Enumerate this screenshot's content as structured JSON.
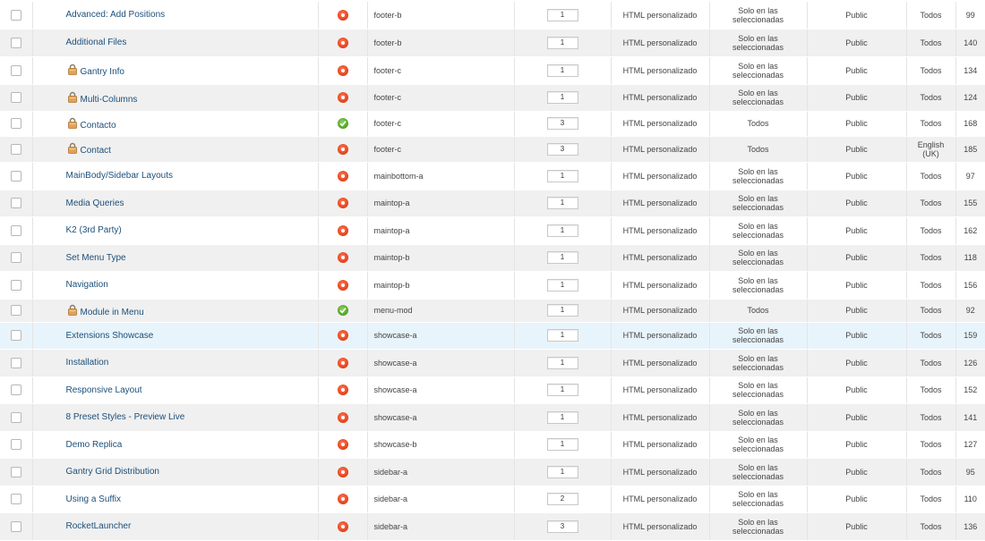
{
  "modules": [
    {
      "title": "Advanced: Add Positions",
      "locked": false,
      "status": "unpublished",
      "position": "footer-b",
      "order": "1",
      "type": "HTML personalizado",
      "pages": "Solo en las seleccionadas",
      "access": "Public",
      "language": "Todos",
      "id": "99"
    },
    {
      "title": "Additional Files",
      "locked": false,
      "status": "unpublished",
      "position": "footer-b",
      "order": "1",
      "type": "HTML personalizado",
      "pages": "Solo en las seleccionadas",
      "access": "Public",
      "language": "Todos",
      "id": "140"
    },
    {
      "title": "Gantry Info",
      "locked": true,
      "status": "unpublished",
      "position": "footer-c",
      "order": "1",
      "type": "HTML personalizado",
      "pages": "Solo en las seleccionadas",
      "access": "Public",
      "language": "Todos",
      "id": "134"
    },
    {
      "title": "Multi-Columns",
      "locked": true,
      "status": "unpublished",
      "position": "footer-c",
      "order": "1",
      "type": "HTML personalizado",
      "pages": "Solo en las seleccionadas",
      "access": "Public",
      "language": "Todos",
      "id": "124"
    },
    {
      "title": "Contacto",
      "locked": true,
      "status": "published",
      "position": "footer-c",
      "order": "3",
      "type": "HTML personalizado",
      "pages": "Todos",
      "access": "Public",
      "language": "Todos",
      "id": "168"
    },
    {
      "title": "Contact",
      "locked": true,
      "status": "unpublished",
      "position": "footer-c",
      "order": "3",
      "type": "HTML personalizado",
      "pages": "Todos",
      "access": "Public",
      "language": "English (UK)",
      "id": "185"
    },
    {
      "title": "MainBody/Sidebar Layouts",
      "locked": false,
      "status": "unpublished",
      "position": "mainbottom-a",
      "order": "1",
      "type": "HTML personalizado",
      "pages": "Solo en las seleccionadas",
      "access": "Public",
      "language": "Todos",
      "id": "97"
    },
    {
      "title": "Media Queries",
      "locked": false,
      "status": "unpublished",
      "position": "maintop-a",
      "order": "1",
      "type": "HTML personalizado",
      "pages": "Solo en las seleccionadas",
      "access": "Public",
      "language": "Todos",
      "id": "155"
    },
    {
      "title": "K2 (3rd Party)",
      "locked": false,
      "status": "unpublished",
      "position": "maintop-a",
      "order": "1",
      "type": "HTML personalizado",
      "pages": "Solo en las seleccionadas",
      "access": "Public",
      "language": "Todos",
      "id": "162"
    },
    {
      "title": "Set Menu Type",
      "locked": false,
      "status": "unpublished",
      "position": "maintop-b",
      "order": "1",
      "type": "HTML personalizado",
      "pages": "Solo en las seleccionadas",
      "access": "Public",
      "language": "Todos",
      "id": "118"
    },
    {
      "title": "Navigation",
      "locked": false,
      "status": "unpublished",
      "position": "maintop-b",
      "order": "1",
      "type": "HTML personalizado",
      "pages": "Solo en las seleccionadas",
      "access": "Public",
      "language": "Todos",
      "id": "156"
    },
    {
      "title": "Module in Menu",
      "locked": true,
      "status": "published",
      "position": "menu-mod",
      "order": "1",
      "type": "HTML personalizado",
      "pages": "Todos",
      "access": "Public",
      "language": "Todos",
      "id": "92"
    },
    {
      "title": "Extensions Showcase",
      "locked": false,
      "status": "unpublished",
      "position": "showcase-a",
      "order": "1",
      "type": "HTML personalizado",
      "pages": "Solo en las seleccionadas",
      "access": "Public",
      "language": "Todos",
      "id": "159",
      "highlight": true
    },
    {
      "title": "Installation",
      "locked": false,
      "status": "unpublished",
      "position": "showcase-a",
      "order": "1",
      "type": "HTML personalizado",
      "pages": "Solo en las seleccionadas",
      "access": "Public",
      "language": "Todos",
      "id": "126"
    },
    {
      "title": "Responsive Layout",
      "locked": false,
      "status": "unpublished",
      "position": "showcase-a",
      "order": "1",
      "type": "HTML personalizado",
      "pages": "Solo en las seleccionadas",
      "access": "Public",
      "language": "Todos",
      "id": "152"
    },
    {
      "title": "8 Preset Styles - Preview Live",
      "locked": false,
      "status": "unpublished",
      "position": "showcase-a",
      "order": "1",
      "type": "HTML personalizado",
      "pages": "Solo en las seleccionadas",
      "access": "Public",
      "language": "Todos",
      "id": "141"
    },
    {
      "title": "Demo Replica",
      "locked": false,
      "status": "unpublished",
      "position": "showcase-b",
      "order": "1",
      "type": "HTML personalizado",
      "pages": "Solo en las seleccionadas",
      "access": "Public",
      "language": "Todos",
      "id": "127"
    },
    {
      "title": "Gantry Grid Distribution",
      "locked": false,
      "status": "unpublished",
      "position": "sidebar-a",
      "order": "1",
      "type": "HTML personalizado",
      "pages": "Solo en las seleccionadas",
      "access": "Public",
      "language": "Todos",
      "id": "95"
    },
    {
      "title": "Using a Suffix",
      "locked": false,
      "status": "unpublished",
      "position": "sidebar-a",
      "order": "2",
      "type": "HTML personalizado",
      "pages": "Solo en las seleccionadas",
      "access": "Public",
      "language": "Todos",
      "id": "110"
    },
    {
      "title": "RocketLauncher",
      "locked": false,
      "status": "unpublished",
      "position": "sidebar-a",
      "order": "3",
      "type": "HTML personalizado",
      "pages": "Solo en las seleccionadas",
      "access": "Public",
      "language": "Todos",
      "id": "136"
    }
  ]
}
